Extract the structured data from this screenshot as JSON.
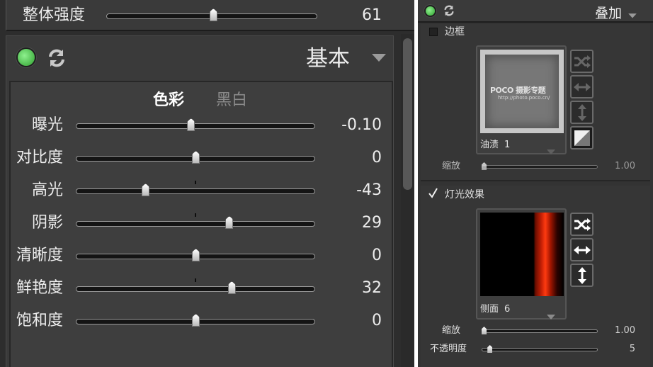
{
  "master": {
    "label": "整体强度",
    "value": "61",
    "fraction": 0.61
  },
  "basic": {
    "title": "基本",
    "tabs": {
      "color": "色彩",
      "bw": "黑白"
    },
    "sliders": [
      {
        "label": "曝光",
        "value": "-0.10",
        "fraction": 0.48
      },
      {
        "label": "对比度",
        "value": "0",
        "fraction": 0.5
      },
      {
        "label": "高光",
        "value": "-43",
        "fraction": 0.29
      },
      {
        "label": "阴影",
        "value": "29",
        "fraction": 0.64
      },
      {
        "label": "清晰度",
        "value": "0",
        "fraction": 0.5
      },
      {
        "label": "鲜艳度",
        "value": "32",
        "fraction": 0.65
      },
      {
        "label": "饱和度",
        "value": "0",
        "fraction": 0.5
      }
    ]
  },
  "overlay": {
    "title": "叠加",
    "border": {
      "label": "边框",
      "checked": false,
      "thumb_name": "油渍",
      "thumb_index": "1",
      "watermark": "POCO 摄影专题",
      "watermark_url": "http://photo.poco.cn/",
      "scale_label": "缩放",
      "scale_value": "1.00",
      "scale_fraction": 0.0
    },
    "light": {
      "label": "灯光效果",
      "checked": true,
      "thumb_name": "侧面",
      "thumb_index": "6",
      "scale_label": "缩放",
      "scale_value": "1.00",
      "scale_fraction": 0.0,
      "opacity_label": "不透明度",
      "opacity_value": "5",
      "opacity_fraction": 0.05
    }
  },
  "colors": {
    "enabled": "#3fbf3f",
    "light_red": "#b11a00"
  }
}
